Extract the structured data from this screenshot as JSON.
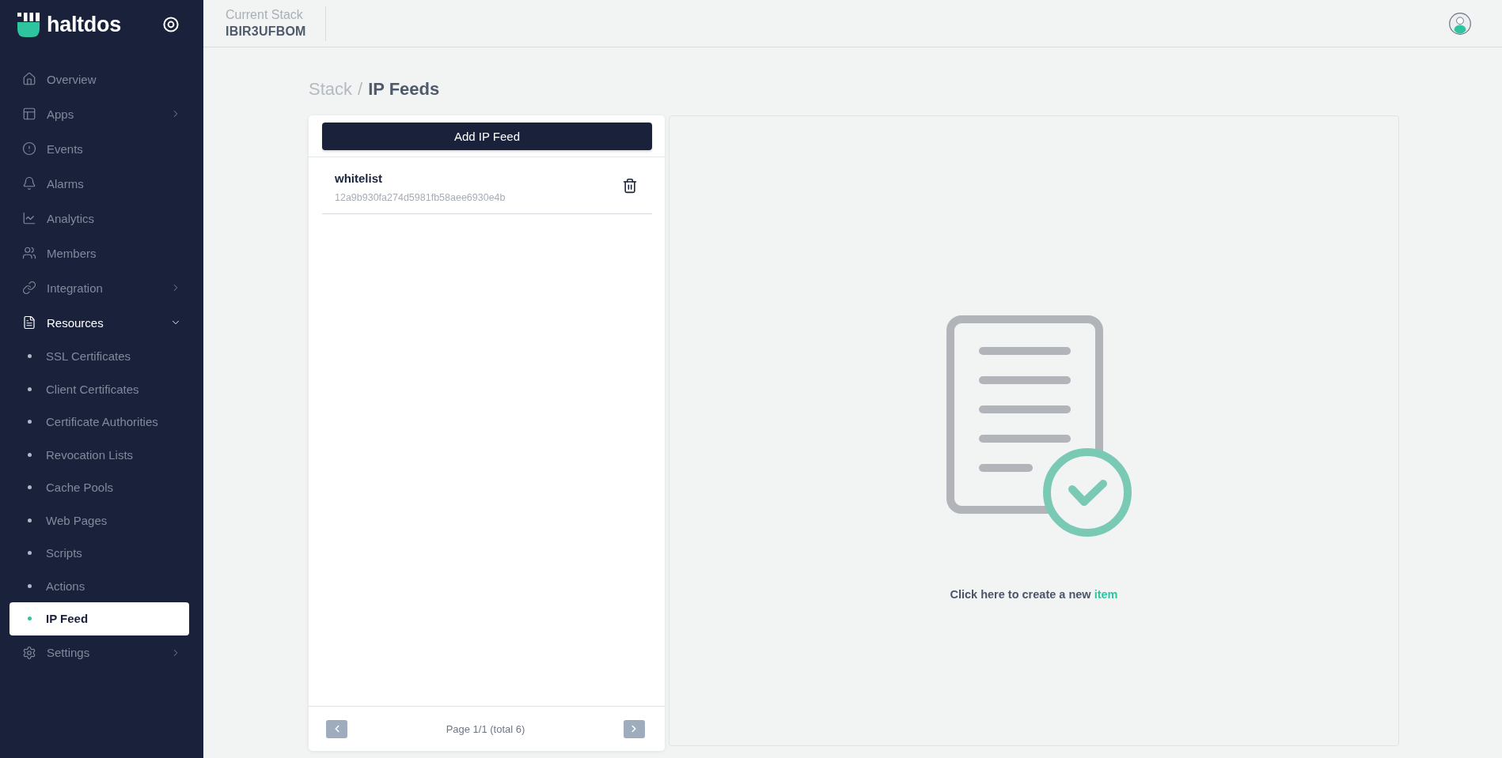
{
  "sidebar": {
    "brand": "haltdos",
    "nav": [
      {
        "label": "Overview",
        "selected": false
      },
      {
        "label": "Apps",
        "selected": false,
        "expanded": false
      },
      {
        "label": "Events",
        "selected": false
      },
      {
        "label": "Alarms",
        "selected": false
      },
      {
        "label": "Analytics",
        "selected": false
      },
      {
        "label": "Members",
        "selected": false
      },
      {
        "label": "Integration",
        "selected": false,
        "expanded": false
      },
      {
        "label": "Resources",
        "selected": false,
        "expanded": true,
        "children": [
          {
            "label": "SSL Certificates",
            "selected": false
          },
          {
            "label": "Client Certificates",
            "selected": false
          },
          {
            "label": "Certificate Authorities",
            "selected": false
          },
          {
            "label": "Revocation Lists",
            "selected": false
          },
          {
            "label": "Cache Pools",
            "selected": false
          },
          {
            "label": "Web Pages",
            "selected": false
          },
          {
            "label": "Scripts",
            "selected": false
          },
          {
            "label": "Actions",
            "selected": false
          },
          {
            "label": "IP Feed",
            "selected": true
          }
        ]
      },
      {
        "label": "Settings",
        "selected": false,
        "expanded": false
      }
    ]
  },
  "header": {
    "stack_label": "Current Stack",
    "stack_name": "IBIR3UFBOM"
  },
  "breadcrumb": {
    "parent": "Stack",
    "separator": "/",
    "current": "IP Feeds"
  },
  "feed_list": {
    "add_button": "Add IP Feed",
    "items": [
      {
        "name": "whitelist",
        "id": "12a9b930fa274d5981fb58aee6930e4b",
        "selected": false
      }
    ],
    "pagination": {
      "prev": {
        "disabled": true
      },
      "label": "Page 1/1 (total 6)",
      "next": {
        "disabled": true
      }
    }
  },
  "empty_state": {
    "prompt": "Click here to create a new",
    "link": "item"
  }
}
